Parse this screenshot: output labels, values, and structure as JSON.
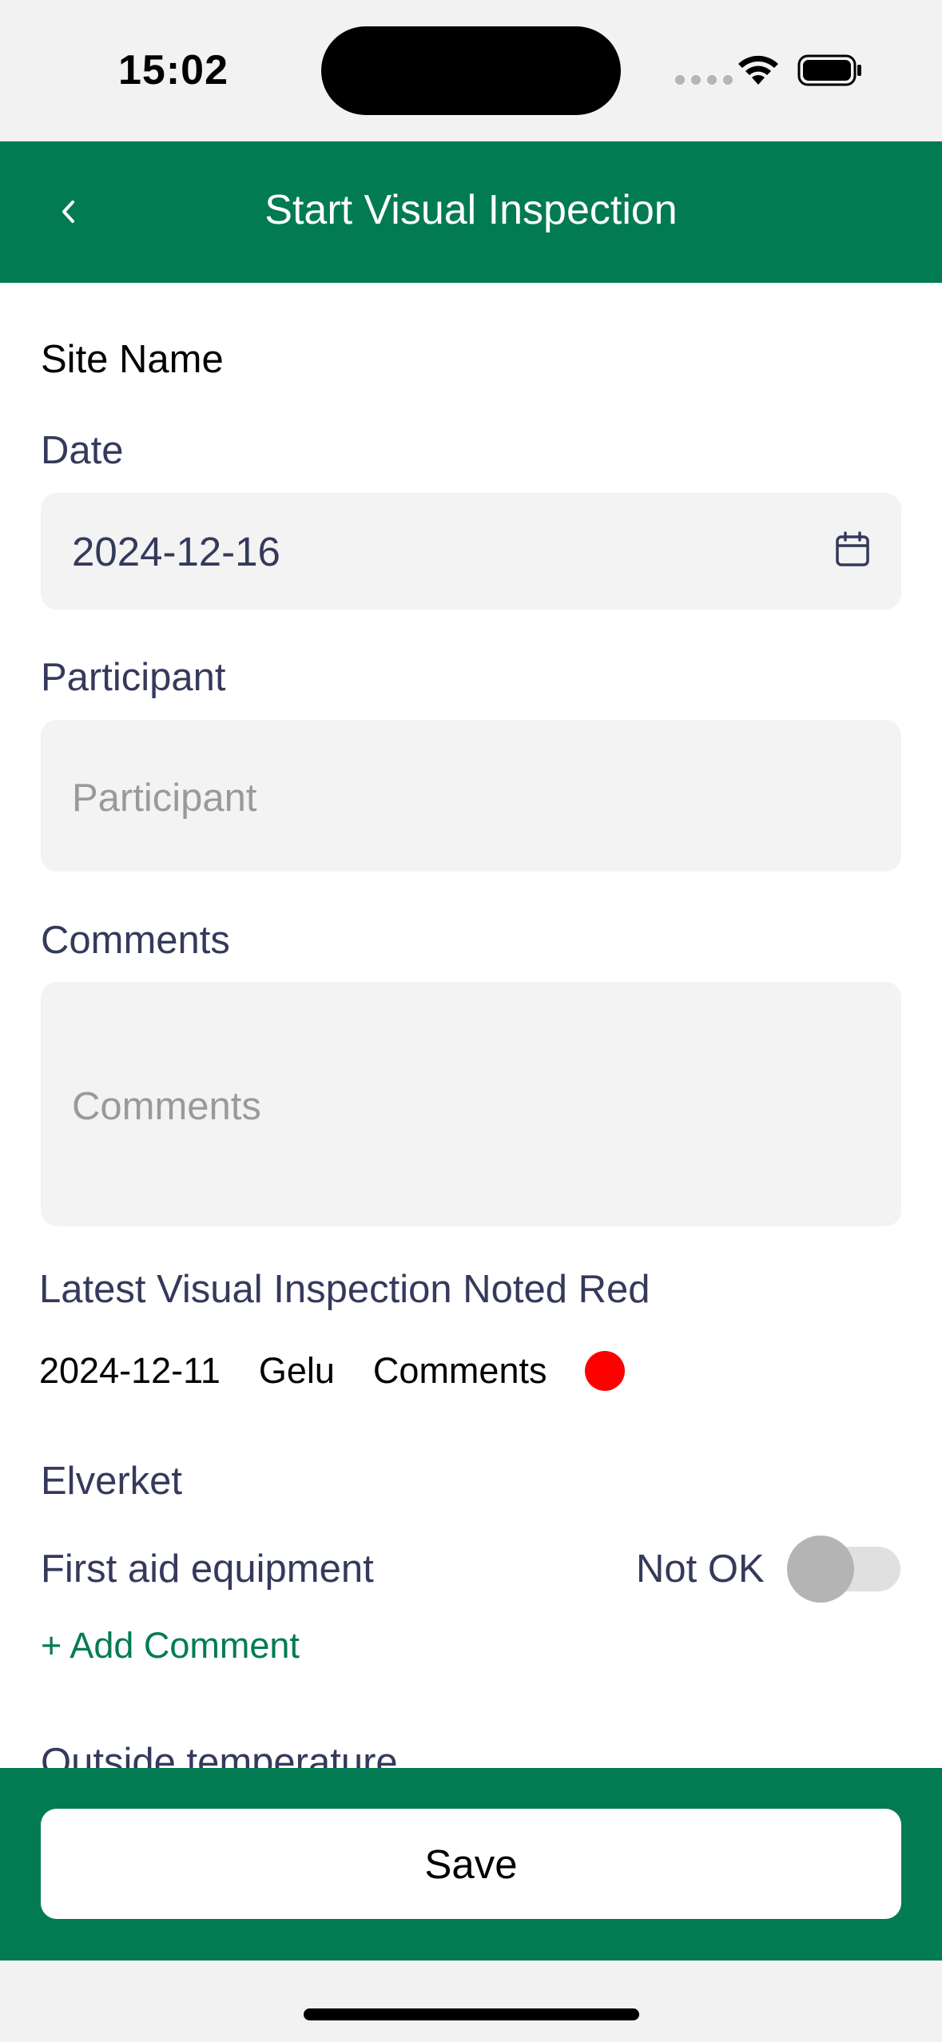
{
  "status_bar": {
    "time": "15:02"
  },
  "header": {
    "title": "Start Visual Inspection",
    "back_icon": "chevron-left-icon"
  },
  "form": {
    "site_name_label": "Site Name",
    "date": {
      "label": "Date",
      "value": "2024-12-16",
      "icon": "calendar-icon"
    },
    "participant": {
      "label": "Participant",
      "placeholder": "Participant"
    },
    "comments": {
      "label": "Comments",
      "placeholder": "Comments"
    }
  },
  "latest_inspection": {
    "heading": "Latest Visual Inspection Noted Red",
    "date": "2024-12-11",
    "participant": "Gelu",
    "comments": "Comments",
    "status_color": "#ff0000"
  },
  "checklist": {
    "group_name": "Elverket",
    "items": [
      {
        "label": "First aid equipment",
        "status": "Not OK",
        "toggle_on": false,
        "add_comment": "+ Add Comment"
      }
    ],
    "next_heading": "Outside temperature"
  },
  "footer": {
    "save_label": "Save"
  },
  "colors": {
    "primary": "#027b52",
    "label_text": "#353a5c",
    "field_bg": "#f3f3f3"
  }
}
